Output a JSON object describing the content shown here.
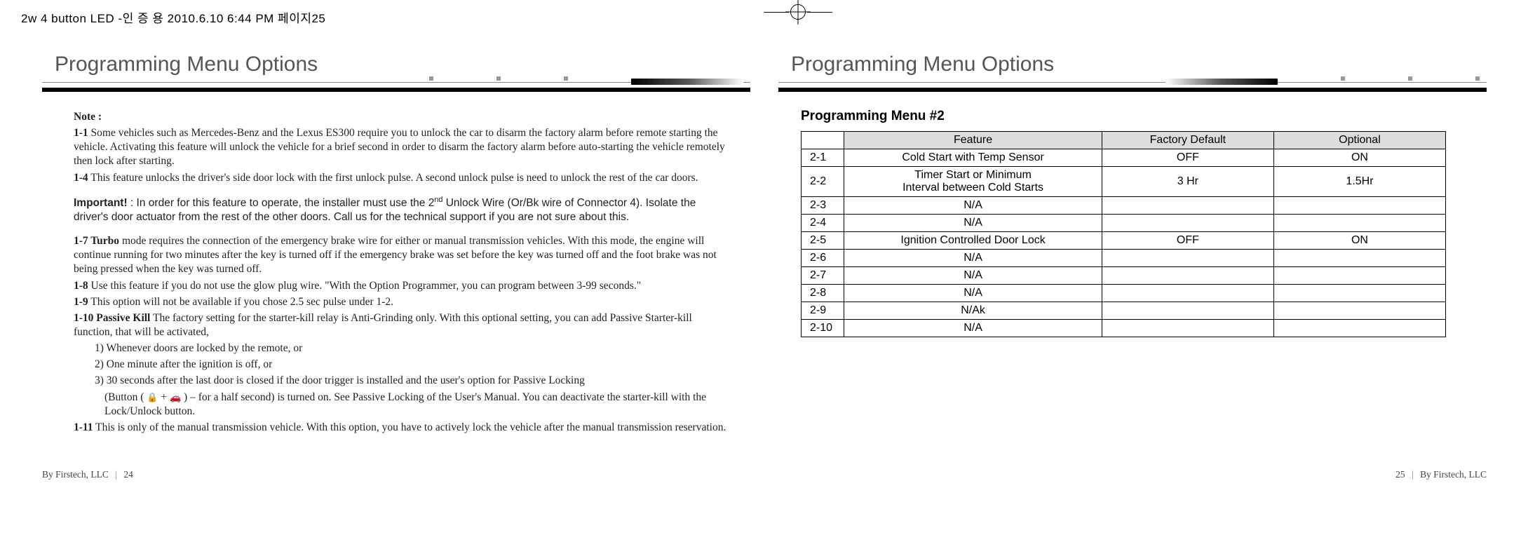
{
  "header": {
    "crop_info": "2w 4 button LED -인 증 용  2010.6.10 6:44 PM  페이지25"
  },
  "left": {
    "title": "Programming Menu Options",
    "note_label": "Note :",
    "p_1_1_tag": "1-1",
    "p_1_1": " Some vehicles such as Mercedes-Benz and the Lexus ES300 require you to unlock the car to disarm the factory alarm before remote starting the vehicle. Activating this feature will unlock the vehicle for a brief second in order to disarm the factory alarm before auto-starting the vehicle remotely then  lock after starting.",
    "p_1_4_tag": "1-4",
    "p_1_4": " This feature unlocks the driver's side door lock with the first unlock pulse. A second unlock pulse is need to unlock the rest of the car doors.",
    "important_label": "Important!",
    "important_a": "  :  In order for this feature to operate, the installer must use the 2",
    "important_sup": "nd",
    "important_b": " Unlock Wire (Or/Bk wire of Connector 4).  Isolate the driver's door actuator from the rest of the other doors.  Call us for the technical support if you are not sure about this.",
    "p_1_7_tag": "1-7",
    "p_1_7_turbo": "  Turbo",
    "p_1_7": "  mode requires the connection of the emergency brake wire for either or manual transmission vehicles.  With this mode, the engine will continue running for two minutes after the key is turned off if the emergency brake was set  before the key was turned off and the foot brake was not being pressed when the key was turned off.",
    "p_1_8_tag": "1-8",
    "p_1_8": "  Use this feature if you do not use the glow plug wire. \"With the Option Programmer, you can program between 3-99 seconds.\"",
    "p_1_9_tag": "1-9",
    "p_1_9": "  This option will not be available if you chose 2.5 sec pulse under 1-2.",
    "p_1_10_tag": "1-10",
    "p_1_10_pk": " Passive Kill",
    "p_1_10": "  The factory setting for the starter-kill relay is Anti-Grinding only. With this optional setting, you can add Passive Starter-kill function, that will be activated,",
    "pk_1": "1) Whenever doors are locked by the remote, or",
    "pk_2": "2) One minute after the ignition is off, or",
    "pk_3a": "3) 30 seconds after the last door is closed if the door trigger is installed and the user's option for Passive Locking",
    "pk_3b_pre": "(Button  ( ",
    "pk_3b_mid": " + ",
    "pk_3b_post": " ) –  for a half second) is turned on.  See Passive Locking of the User's Manual.  You can deactivate the starter-kill with the Lock/Unlock button.",
    "p_1_11_tag": "1-11",
    "p_1_11": " This is only of the manual transmission vehicle. With this option, you have to actively lock the vehicle after the manual transmission reservation.",
    "footer_by": "By Firstech, LLC",
    "footer_page": "24"
  },
  "right": {
    "title": "Programming Menu Options",
    "subheading": "Programming Menu #2",
    "th_feature": "Feature",
    "th_default": "Factory Default",
    "th_optional": "Optional",
    "rows": [
      {
        "idx": "2-1",
        "feature": "Cold Start with Temp Sensor",
        "def": "OFF",
        "opt": "ON"
      },
      {
        "idx": "2-2",
        "feature": "Timer Start or Minimum\nInterval between Cold Starts",
        "def": "3 Hr",
        "opt": "1.5Hr"
      },
      {
        "idx": "2-3",
        "feature": "N/A",
        "def": "",
        "opt": ""
      },
      {
        "idx": "2-4",
        "feature": "N/A",
        "def": "",
        "opt": ""
      },
      {
        "idx": "2-5",
        "feature": "Ignition Controlled  Door Lock",
        "def": "OFF",
        "opt": "ON"
      },
      {
        "idx": "2-6",
        "feature": "N/A",
        "def": "",
        "opt": ""
      },
      {
        "idx": "2-7",
        "feature": "N/A",
        "def": "",
        "opt": ""
      },
      {
        "idx": "2-8",
        "feature": "N/A",
        "def": "",
        "opt": ""
      },
      {
        "idx": "2-9",
        "feature": "N/Ak",
        "def": "",
        "opt": ""
      },
      {
        "idx": "2-10",
        "feature": "N/A",
        "def": "",
        "opt": ""
      }
    ],
    "footer_by": "By Firstech, LLC",
    "footer_page": "25"
  }
}
